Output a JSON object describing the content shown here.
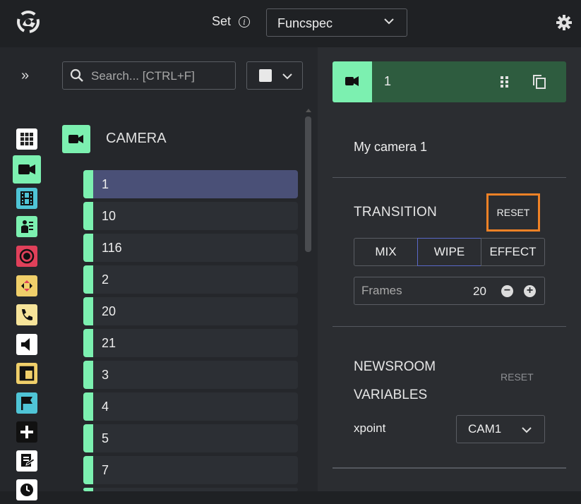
{
  "header": {
    "set_label": "Set",
    "set_value": "Funcspec"
  },
  "search": {
    "placeholder": "Search... [CTRL+F]"
  },
  "category": {
    "title": "CAMERA",
    "color": "#7cf0b0"
  },
  "list": {
    "items": [
      "1",
      "10",
      "116",
      "2",
      "20",
      "21",
      "3",
      "4",
      "5",
      "7"
    ],
    "selected": "1"
  },
  "sidebar": {
    "icons": [
      {
        "name": "grid-icon",
        "color": "#ffffff"
      },
      {
        "name": "video-camera-icon",
        "color": "#7cf0b0"
      },
      {
        "name": "film-icon",
        "color": "#4fc4d6"
      },
      {
        "name": "presenter-icon",
        "color": "#7cf0b0"
      },
      {
        "name": "record-icon",
        "color": "#e0405a"
      },
      {
        "name": "transition-icon",
        "color": "#f0cf6a"
      },
      {
        "name": "phone-icon",
        "color": "#f7e49a"
      },
      {
        "name": "speaker-icon",
        "color": "#ffffff"
      },
      {
        "name": "layout-icon",
        "color": "#f0cf6a"
      },
      {
        "name": "flag-icon",
        "color": "#4fc4d6"
      },
      {
        "name": "plus-icon",
        "color": "#ffffff"
      },
      {
        "name": "script-icon",
        "color": "#ffffff"
      },
      {
        "name": "clock-icon",
        "color": "#ffffff"
      }
    ]
  },
  "detail": {
    "header_title": "1",
    "camera_name": "My camera 1",
    "transition": {
      "title": "TRANSITION",
      "reset_label": "RESET",
      "options": [
        "MIX",
        "WIPE",
        "EFFECT"
      ],
      "active": "WIPE",
      "frames_label": "Frames",
      "frames_value": "20"
    },
    "newsroom": {
      "title": "NEWSROOM VARIABLES",
      "reset_label": "RESET",
      "xpoint_label": "xpoint",
      "xpoint_value": "CAM1"
    }
  },
  "colors": {
    "accent_green": "#7cf0b0",
    "header_green": "#2e5c3f",
    "selected_row": "#4a5077",
    "highlight_orange": "#f08226"
  }
}
